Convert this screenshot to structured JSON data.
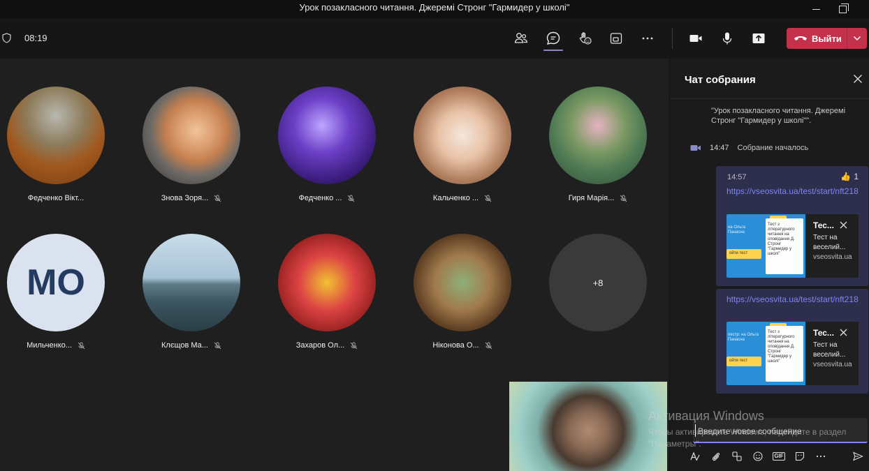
{
  "window": {
    "title": "Урок позакласного читання. Джеремі Стронг \"Гармидер у школі\""
  },
  "toolbar": {
    "timer": "08:19",
    "leave_label": "Выйти",
    "icons": [
      "shield-icon",
      "participants-icon",
      "chat-icon",
      "reactions-icon",
      "rooms-icon",
      "more-icon",
      "camera-icon",
      "mic-icon",
      "share-icon",
      "phone-icon",
      "chevron-down-icon"
    ],
    "colors": {
      "leave": "#c4314b",
      "accent": "#7f85f5"
    }
  },
  "participants": [
    {
      "name": "Федченко Вікт...",
      "muted": false
    },
    {
      "name": "Знова Зоря...",
      "muted": true
    },
    {
      "name": "Федченко ...",
      "muted": true
    },
    {
      "name": "Кальченко ...",
      "muted": true
    },
    {
      "name": "Гиря Марія...",
      "muted": true
    },
    {
      "name": "Мильченко...",
      "muted": true,
      "initials": "МО"
    },
    {
      "name": "Клєщов Ма...",
      "muted": true
    },
    {
      "name": "Захаров Ол...",
      "muted": true
    },
    {
      "name": "Ніконова О...",
      "muted": true
    }
  ],
  "overflow": {
    "label": "+8"
  },
  "chat": {
    "title": "Чат собрания",
    "system_message": "\"Урок позакласного читання. Джеремі Стронг \"Гармидер у школі\"\".",
    "meeting_started": {
      "time": "14:47",
      "text": "Собрание началось"
    },
    "messages": [
      {
        "time": "14:57",
        "reaction": {
          "emoji": "👍",
          "count": "1"
        },
        "link": "https://vseosvita.ua/test/start/nft218",
        "card": {
          "title": "Тес...",
          "desc": "Тест на веселий...",
          "domain": "vseosvita.ua",
          "thumb_text": "Тест з літературного читання на оповідання Д. Стронг \"Гармидер у школі\"",
          "thumb_left": "на Ольга Панасна",
          "thumb_button": "ойти тест"
        }
      },
      {
        "link": "https://vseosvita.ua/test/start/nft218",
        "card": {
          "title": "Тес...",
          "desc": "Тест на веселий...",
          "domain": "vseosvita.ua",
          "thumb_text": "Тест з літературного читання на оповідання Д. Стронг \"Гармидер у школі\"",
          "thumb_left": "пестр: на Ольга Панасна",
          "thumb_button": "ойти тест"
        }
      }
    ],
    "compose_placeholder": "Введите новое сообщение"
  },
  "watermark": {
    "line1": "Активация Windows",
    "line2": "Чтобы активировать Windows, перейдите в раздел \"Параметры\"."
  }
}
